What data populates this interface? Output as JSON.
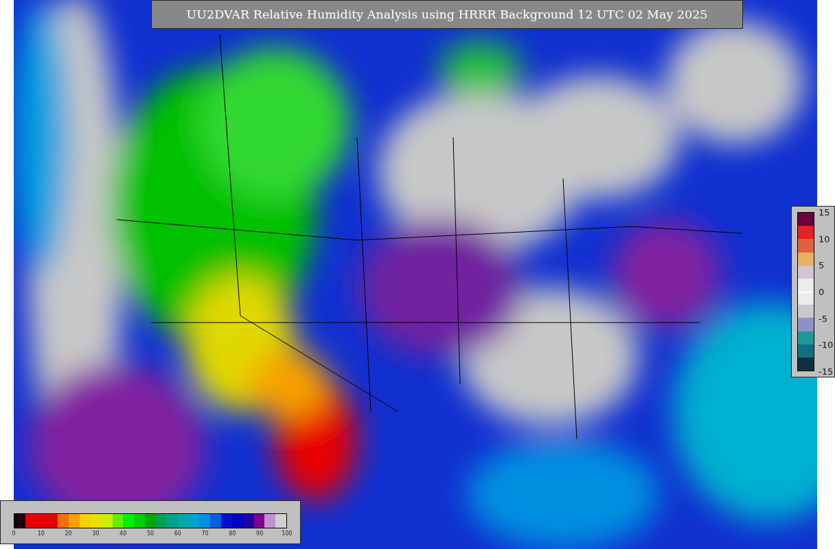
{
  "title": "UU2DVAR Relative Humidity Analysis using HRRR Background 12 UTC 02 May 2025",
  "humidity_colorbar": {
    "segments": [
      {
        "color": "#200008"
      },
      {
        "color": "#e80000"
      },
      {
        "color": "#e80000"
      },
      {
        "color": "#e80000"
      },
      {
        "color": "#f07010"
      },
      {
        "color": "#f8a000"
      },
      {
        "color": "#f8d000"
      },
      {
        "color": "#e8e000"
      },
      {
        "color": "#c8f000"
      },
      {
        "color": "#60f000"
      },
      {
        "color": "#00f000"
      },
      {
        "color": "#00d000"
      },
      {
        "color": "#00a800"
      },
      {
        "color": "#00a050"
      },
      {
        "color": "#00a090"
      },
      {
        "color": "#00a8a8"
      },
      {
        "color": "#00a0d0"
      },
      {
        "color": "#0090e0"
      },
      {
        "color": "#0060e0"
      },
      {
        "color": "#0010d0"
      },
      {
        "color": "#0000c0"
      },
      {
        "color": "#2000a0"
      },
      {
        "color": "#800090"
      },
      {
        "color": "#c090d0"
      },
      {
        "color": "#d0d0d0"
      }
    ],
    "ticks": [
      "0",
      "10",
      "20",
      "30",
      "40",
      "50",
      "60",
      "70",
      "80",
      "90",
      "100"
    ]
  },
  "difference_colorbar": {
    "segments": [
      {
        "color": "#6a0040"
      },
      {
        "color": "#e82020"
      },
      {
        "color": "#e06040"
      },
      {
        "color": "#e8b060"
      },
      {
        "color": "#d0c8d0"
      },
      {
        "color": "#ececec"
      },
      {
        "color": "#ececec"
      },
      {
        "color": "#c8c8d0"
      },
      {
        "color": "#9090c8"
      },
      {
        "color": "#209898"
      },
      {
        "color": "#107080"
      },
      {
        "color": "#103040"
      }
    ],
    "ticks": [
      "15",
      "10",
      "5",
      "0",
      "-5",
      "-10",
      "-15"
    ]
  }
}
